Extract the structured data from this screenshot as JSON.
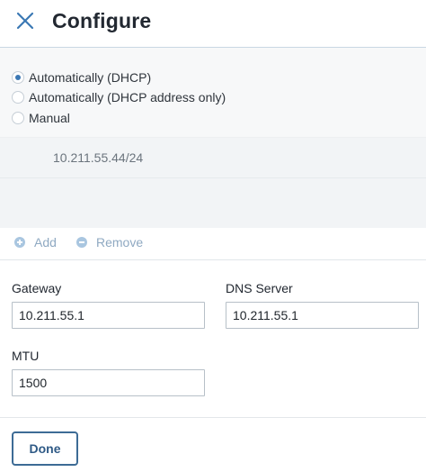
{
  "header": {
    "title": "Configure",
    "close_icon": "close-icon"
  },
  "ip_mode": {
    "options": [
      {
        "label": "Automatically (DHCP)",
        "checked": true
      },
      {
        "label": "Automatically (DHCP address only)",
        "checked": false
      },
      {
        "label": "Manual",
        "checked": false
      }
    ]
  },
  "addresses": [
    "10.211.55.44/24"
  ],
  "toolbar": {
    "add_label": "Add",
    "remove_label": "Remove",
    "add_icon": "plus-circle-icon",
    "remove_icon": "minus-circle-icon"
  },
  "form": {
    "gateway_label": "Gateway",
    "gateway_value": "10.211.55.1",
    "dns_label": "DNS Server",
    "dns_value": "10.211.55.1",
    "mtu_label": "MTU",
    "mtu_value": "1500"
  },
  "actions": {
    "done_label": "Done"
  },
  "colors": {
    "accent": "#3b78b4",
    "button_border": "#3d6b95",
    "toolbar_text": "#8fa9c2"
  }
}
